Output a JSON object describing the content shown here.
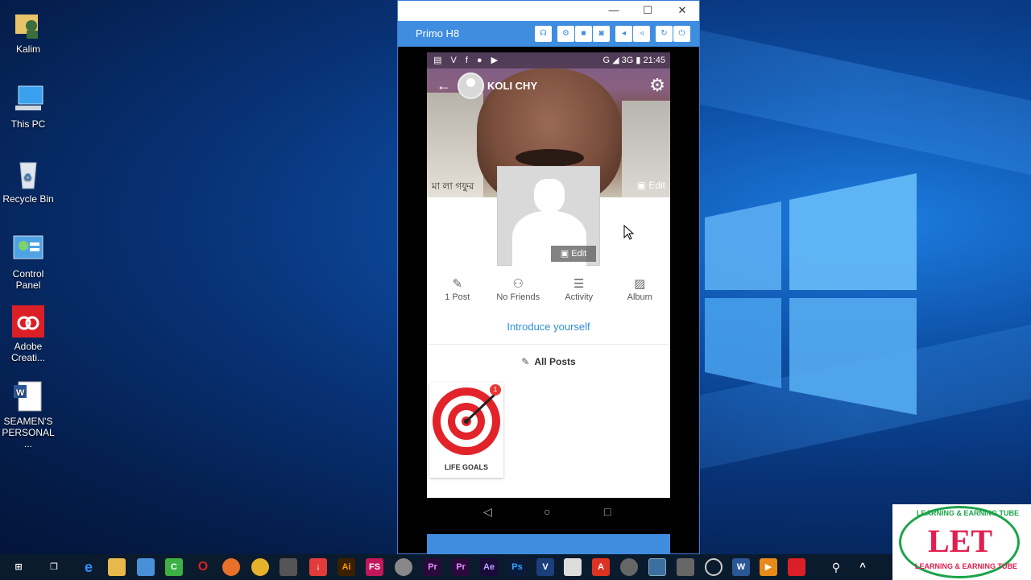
{
  "desktop": {
    "icons": [
      {
        "label": "Kalim"
      },
      {
        "label": "This PC"
      },
      {
        "label": "Recycle Bin"
      },
      {
        "label": "Control Panel"
      },
      {
        "label": "Adobe Creati..."
      },
      {
        "label": "SEAMEN'S PERSONAL ..."
      }
    ]
  },
  "emulator": {
    "title": "Primo H8",
    "window_buttons": {
      "minimize": "—",
      "maximize": "☐",
      "close": "✕"
    }
  },
  "phone": {
    "status": {
      "time": "21:45",
      "network": "G ◢ 3G",
      "left_icons": "▤ V f ● ▶"
    },
    "profile": {
      "name": "KOLI CHY",
      "cover_edit_label": "Edit",
      "photo_edit_label": "Edit",
      "cover_sign_text": "মা লা গফুর"
    },
    "stats": [
      {
        "label": "1 Post",
        "icon": "post-icon"
      },
      {
        "label": "No Friends",
        "icon": "friends-icon"
      },
      {
        "label": "Activity",
        "icon": "activity-icon"
      },
      {
        "label": "Album",
        "icon": "album-icon"
      }
    ],
    "introduce_label": "Introduce yourself",
    "all_posts_label": "All Posts",
    "post_card": {
      "label": "LIFE GOALS",
      "badge": "1"
    }
  },
  "taskbar": {
    "apps": [
      "Windows",
      "Task View",
      "Edge",
      "File Explorer",
      "Store",
      "Camtasia",
      "Opera",
      "Firefox",
      "Chrome",
      "Video",
      "Downloader",
      "Ai",
      "FS",
      "Paint",
      "Pr",
      "Pr",
      "Ae",
      "Ps",
      "V",
      "Excel",
      "Acrobat",
      "App",
      "Active",
      "Tool",
      "Globe",
      "W",
      "Player",
      "Adobe CC"
    ]
  },
  "watermark": {
    "main": "LET",
    "top": "LEARNING & EARNING TUBE",
    "bottom": "LEARNING & EARNING TUBE"
  },
  "colors": {
    "accent": "#3f8ddf",
    "link": "#2f8fd8",
    "badge": "#e53935"
  }
}
